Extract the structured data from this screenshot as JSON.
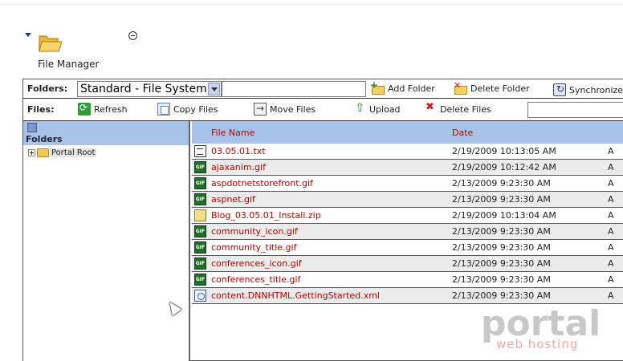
{
  "module": {
    "title": "File Manager",
    "icons": {
      "collapse": "triangle-down-icon",
      "folder": "open-folder-icon",
      "minimize": "minus-circle-icon"
    }
  },
  "toolbar": {
    "folders_label": "Folders:",
    "folder_select_value": "Standard - File System",
    "add_folder": "Add Folder",
    "delete_folder": "Delete Folder",
    "synchronize": "Synchronize",
    "files_label": "Files:",
    "refresh": "Refresh",
    "copy_files": "Copy Files",
    "move_files": "Move Files",
    "upload": "Upload",
    "delete_files": "Delete Files"
  },
  "folders_pane": {
    "header": "Folders",
    "tree": [
      {
        "label": "Portal Root",
        "expanded": false
      }
    ]
  },
  "files_pane": {
    "columns": {
      "name": "File Name",
      "date": "Date"
    },
    "rows": [
      {
        "name": "03.05.01.txt",
        "date": "2/19/2009 10:13:05 AM",
        "attr": "A",
        "type": "txt"
      },
      {
        "name": "ajaxanim.gif",
        "date": "2/19/2009 10:12:42 AM",
        "attr": "A",
        "type": "gif"
      },
      {
        "name": "aspdotnetstorefront.gif",
        "date": "2/13/2009 9:23:30 AM",
        "attr": "A",
        "type": "gif"
      },
      {
        "name": "aspnet.gif",
        "date": "2/13/2009 9:23:30 AM",
        "attr": "A",
        "type": "gif"
      },
      {
        "name": "Blog_03.05.01_Install.zip",
        "date": "2/19/2009 10:13:04 AM",
        "attr": "A",
        "type": "zip"
      },
      {
        "name": "community_icon.gif",
        "date": "2/13/2009 9:23:30 AM",
        "attr": "A",
        "type": "gif"
      },
      {
        "name": "community_title.gif",
        "date": "2/13/2009 9:23:30 AM",
        "attr": "A",
        "type": "gif"
      },
      {
        "name": "conferences_icon.gif",
        "date": "2/13/2009 9:23:30 AM",
        "attr": "A",
        "type": "gif"
      },
      {
        "name": "conferences_title.gif",
        "date": "2/13/2009 9:23:30 AM",
        "attr": "A",
        "type": "gif"
      },
      {
        "name": "content.DNNHTML.GettingStarted.xml",
        "date": "2/13/2009 9:23:30 AM",
        "attr": "A",
        "type": "xml"
      }
    ]
  },
  "watermark": {
    "main": "portal",
    "sub": "web hosting"
  },
  "colors": {
    "header_blue": "#a9c2e8",
    "link_red": "#c00000",
    "row_alt": "#ebebeb"
  }
}
